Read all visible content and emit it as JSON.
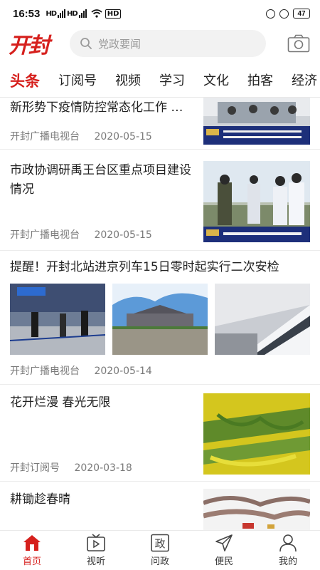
{
  "status_bar": {
    "time": "16:53",
    "network_1": "HD",
    "network_2": "HD",
    "battery": "47"
  },
  "header": {
    "logo_text": "开封",
    "search_placeholder": "党政要闻"
  },
  "tabs": [
    "头条",
    "订阅号",
    "视频",
    "学习",
    "文化",
    "拍客",
    "经济"
  ],
  "feed": [
    {
      "title": "新形势下疫情防控常态化工作 …",
      "source": "开封广播电视台",
      "date": "2020-05-15"
    },
    {
      "title": "市政协调研禹王台区重点项目建设情况",
      "source": "开封广播电视台",
      "date": "2020-05-15"
    },
    {
      "title": "提醒！开封北站进京列车15日零时起实行二次安检",
      "source": "开封广播电视台",
      "date": "2020-05-14"
    },
    {
      "title": "花开烂漫 春光无限",
      "source": "开封订阅号",
      "date": "2020-03-18"
    },
    {
      "title": "耕锄趁春晴",
      "source": "",
      "date": ""
    }
  ],
  "bottom_nav": [
    {
      "label": "首页",
      "icon": "home-icon"
    },
    {
      "label": "视听",
      "icon": "tv-icon"
    },
    {
      "label": "问政",
      "icon": "zheng-icon"
    },
    {
      "label": "便民",
      "icon": "send-icon"
    },
    {
      "label": "我的",
      "icon": "person-icon"
    }
  ],
  "colors": {
    "accent": "#d6201d",
    "text": "#222222",
    "muted": "#7a7a7a"
  }
}
